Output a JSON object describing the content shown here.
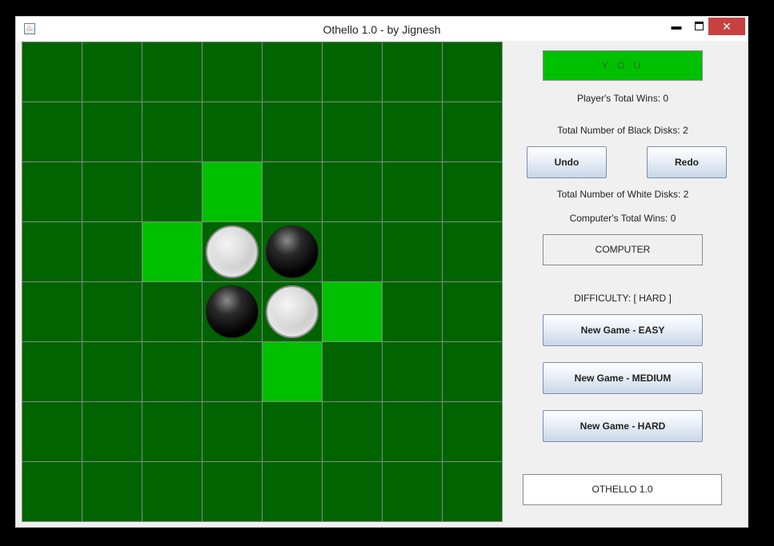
{
  "window": {
    "title": "Othello 1.0 - by Jignesh",
    "minimize_glyph": "▬",
    "close_glyph": "✕",
    "app_icon": "java-cup-icon"
  },
  "board": {
    "rows": 8,
    "cols": 8,
    "colors": {
      "cell": "#006400",
      "hint": "#00c000",
      "grid": "#7e8f80"
    },
    "hints": [
      [
        2,
        3
      ],
      [
        3,
        2
      ],
      [
        4,
        5
      ],
      [
        5,
        4
      ]
    ],
    "disks": [
      {
        "row": 3,
        "col": 3,
        "color": "white"
      },
      {
        "row": 3,
        "col": 4,
        "color": "black"
      },
      {
        "row": 4,
        "col": 3,
        "color": "black"
      },
      {
        "row": 4,
        "col": 4,
        "color": "white"
      }
    ]
  },
  "panel": {
    "turn_label": "Y O U",
    "player_wins": "Player's Total Wins: 0",
    "black_disks": "Total Number of Black Disks: 2",
    "undo_label": "Undo",
    "redo_label": "Redo",
    "white_disks": "Total Number of White Disks: 2",
    "computer_wins": "Computer's Total Wins: 0",
    "computer_label": "COMPUTER",
    "difficulty": "DIFFICULTY: [ HARD ]",
    "new_easy": "New Game - EASY",
    "new_medium": "New Game - MEDIUM",
    "new_hard": "New Game - HARD",
    "footer": "OTHELLO 1.0"
  }
}
